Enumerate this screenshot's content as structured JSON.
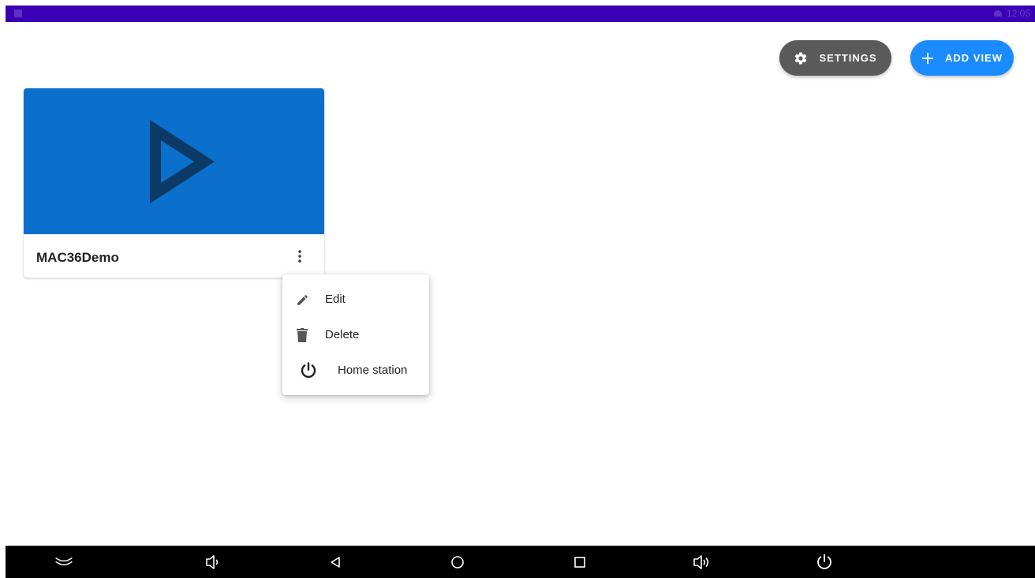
{
  "status_bar": {
    "time": "12:05"
  },
  "toolbar": {
    "settings_label": "SETTINGS",
    "add_view_label": "ADD VIEW"
  },
  "card": {
    "title": "MAC36Demo"
  },
  "context_menu": {
    "items": [
      {
        "label": "Edit",
        "icon": "pencil-icon"
      },
      {
        "label": "Delete",
        "icon": "trash-icon"
      },
      {
        "label": "Home station",
        "icon": "power-icon"
      }
    ]
  },
  "nav_bar": {
    "icons": [
      "collapse-icon",
      "volume-down-icon",
      "back-icon",
      "home-icon",
      "recents-icon",
      "volume-up-icon",
      "power-icon"
    ]
  },
  "colors": {
    "status_bar": "#3b00b3",
    "settings_button": "#5a5a5a",
    "add_view_button": "#1a8cff",
    "card_media": "#0a70cc",
    "play_icon": "#0b3a66",
    "nav_bar": "#000000"
  }
}
